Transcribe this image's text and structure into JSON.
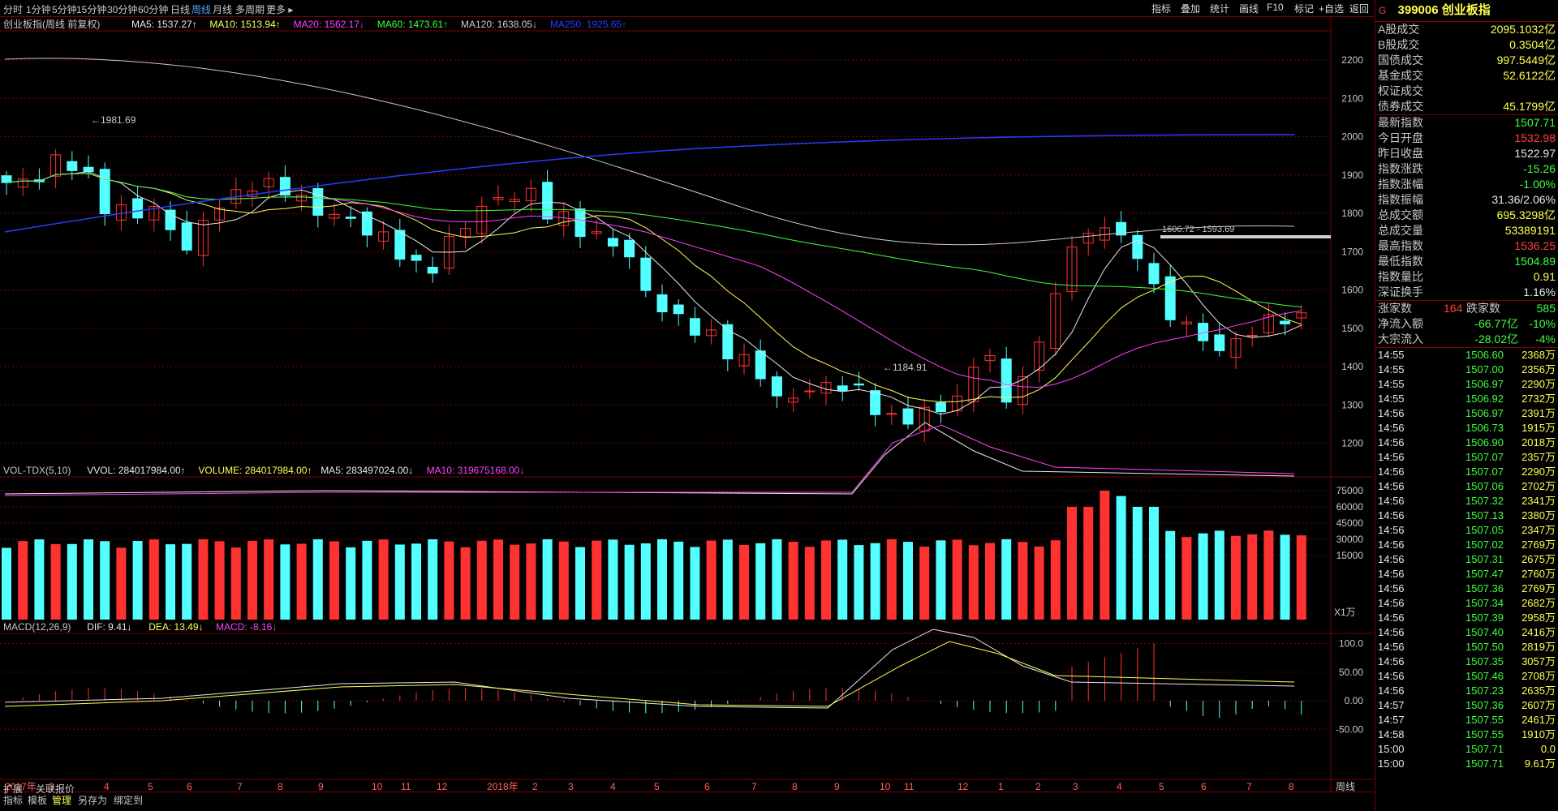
{
  "periods": [
    "分时",
    "1分钟",
    "5分钟",
    "15分钟",
    "30分钟",
    "60分钟",
    "日线",
    "周线",
    "月线",
    "多周期",
    "更多"
  ],
  "active_period": "周线",
  "tools": [
    "指标",
    "叠加",
    "统计",
    "画线",
    "F10",
    "标记",
    "+自选",
    "返回"
  ],
  "main_title": "创业板指(周线 前复权)",
  "ma_legend": [
    {
      "label": "MA5: 1537.27",
      "arrow": "↑",
      "color": "#e8e8e8"
    },
    {
      "label": "MA10: 1513.94",
      "arrow": "↑",
      "color": "#ffff54"
    },
    {
      "label": "MA20: 1562.17",
      "arrow": "↓",
      "color": "#ff40ff"
    },
    {
      "label": "MA60: 1473.61",
      "arrow": "↑",
      "color": "#40ff40"
    },
    {
      "label": "MA120: 1638.05",
      "arrow": "↓",
      "color": "#cccccc"
    },
    {
      "label": "MA250: 1925.65",
      "arrow": "↑",
      "color": "#2b3bff"
    }
  ],
  "price_axis": [
    "2200",
    "2100",
    "2000",
    "1900",
    "1800",
    "1700",
    "1600",
    "1500",
    "1400",
    "1300",
    "1200"
  ],
  "annotations": {
    "high": "1981.69",
    "low": "1184.91",
    "range": "1606.72 - 1593.69"
  },
  "vol_legend": [
    {
      "label": "VOL-TDX(5,10)",
      "color": "#c8c8c8"
    },
    {
      "label": "VVOL: 284017984.00",
      "arrow": "↑",
      "color": "#e8e8e8"
    },
    {
      "label": "VOLUME: 284017984.00",
      "arrow": "↑",
      "color": "#ffff54"
    },
    {
      "label": "MA5: 283497024.00",
      "arrow": "↓",
      "color": "#e8e8e8"
    },
    {
      "label": "MA10: 319675168.00",
      "arrow": "↓",
      "color": "#ff40ff"
    }
  ],
  "vol_axis": [
    "75000",
    "60000",
    "45000",
    "30000",
    "15000"
  ],
  "vol_unit": "X1万",
  "macd_legend": [
    {
      "label": "MACD(12,26,9)",
      "color": "#c8c8c8"
    },
    {
      "label": "DIF: 9.41",
      "arrow": "↓",
      "color": "#e8e8e8"
    },
    {
      "label": "DEA: 13.49",
      "arrow": "↓",
      "color": "#ffff54"
    },
    {
      "label": "MACD: -8.16",
      "arrow": "↓",
      "color": "#ff40ff"
    }
  ],
  "macd_axis": [
    "100.0",
    "50.00",
    "0.00",
    "-50.00"
  ],
  "date_labels": [
    "2017年",
    "3",
    "4",
    "5",
    "6",
    "7",
    "8",
    "9",
    "10",
    "11",
    "12",
    "2018年",
    "2",
    "3",
    "4",
    "5",
    "6",
    "7",
    "8",
    "9",
    "10",
    "11",
    "12",
    "1",
    "2",
    "3",
    "4",
    "5",
    "6",
    "7",
    "8"
  ],
  "date_axis_period": "周线",
  "bottom_tabs": [
    "指标",
    "模板",
    "管理",
    "另存为",
    "绑定到"
  ],
  "bottom_tabs2": [
    "扩展",
    "关联报价"
  ],
  "quote": {
    "code": "399006",
    "name": "创业板指",
    "g": "G",
    "stats1": [
      {
        "l": "A股成交",
        "v": "2095.1032亿",
        "c": "#ffff54"
      },
      {
        "l": "B股成交",
        "v": "0.3504亿",
        "c": "#ffff54"
      },
      {
        "l": "国债成交",
        "v": "997.5449亿",
        "c": "#ffff54"
      },
      {
        "l": "基金成交",
        "v": "52.6122亿",
        "c": "#ffff54"
      },
      {
        "l": "权证成交",
        "v": "",
        "c": "#ffff54"
      },
      {
        "l": "债券成交",
        "v": "45.1799亿",
        "c": "#ffff54"
      }
    ],
    "stats2": [
      {
        "l": "最新指数",
        "v": "1507.71",
        "c": "#40ff40"
      },
      {
        "l": "今日开盘",
        "v": "1532.98",
        "c": "#ff4040"
      },
      {
        "l": "昨日收盘",
        "v": "1522.97",
        "c": "#e8e8e8"
      },
      {
        "l": "指数涨跌",
        "v": "-15.26",
        "c": "#40ff40"
      },
      {
        "l": "指数涨幅",
        "v": "-1.00%",
        "c": "#40ff40"
      },
      {
        "l": "指数振幅",
        "v": "31.36/2.06%",
        "c": "#e8e8e8"
      },
      {
        "l": "总成交额",
        "v": "695.3298亿",
        "c": "#ffff54"
      },
      {
        "l": "总成交量",
        "v": "53389191",
        "c": "#ffff54"
      },
      {
        "l": "最高指数",
        "v": "1536.25",
        "c": "#ff4040"
      },
      {
        "l": "最低指数",
        "v": "1504.89",
        "c": "#40ff40"
      },
      {
        "l": "指数量比",
        "v": "0.91",
        "c": "#ffff54"
      },
      {
        "l": "深证换手",
        "v": "1.16%",
        "c": "#e8e8e8"
      }
    ],
    "up_label": "涨家数",
    "up_count": "164",
    "down_label": "跌家数",
    "down_count": "585",
    "flow": [
      {
        "l": "净流入额",
        "v": "-66.77亿",
        "p": "-10%"
      },
      {
        "l": "大宗流入",
        "v": "-28.02亿",
        "p": "-4%"
      }
    ],
    "ticks": [
      [
        "14:55",
        "1506.60",
        "2368万"
      ],
      [
        "14:55",
        "1507.00",
        "2356万"
      ],
      [
        "14:55",
        "1506.97",
        "2290万"
      ],
      [
        "14:55",
        "1506.92",
        "2732万"
      ],
      [
        "14:56",
        "1506.97",
        "2391万"
      ],
      [
        "14:56",
        "1506.73",
        "1915万"
      ],
      [
        "14:56",
        "1506.90",
        "2018万"
      ],
      [
        "14:56",
        "1507.07",
        "2357万"
      ],
      [
        "14:56",
        "1507.07",
        "2290万"
      ],
      [
        "14:56",
        "1507.06",
        "2702万"
      ],
      [
        "14:56",
        "1507.32",
        "2341万"
      ],
      [
        "14:56",
        "1507.13",
        "2380万"
      ],
      [
        "14:56",
        "1507.05",
        "2347万"
      ],
      [
        "14:56",
        "1507.02",
        "2769万"
      ],
      [
        "14:56",
        "1507.31",
        "2675万"
      ],
      [
        "14:56",
        "1507.47",
        "2760万"
      ],
      [
        "14:56",
        "1507.36",
        "2769万"
      ],
      [
        "14:56",
        "1507.34",
        "2682万"
      ],
      [
        "14:56",
        "1507.39",
        "2958万"
      ],
      [
        "14:56",
        "1507.40",
        "2416万"
      ],
      [
        "14:56",
        "1507.50",
        "2819万"
      ],
      [
        "14:56",
        "1507.35",
        "3057万"
      ],
      [
        "14:56",
        "1507.46",
        "2708万"
      ],
      [
        "14:56",
        "1507.23",
        "2635万"
      ],
      [
        "14:57",
        "1507.36",
        "2607万"
      ],
      [
        "14:57",
        "1507.55",
        "2461万"
      ],
      [
        "14:58",
        "1507.55",
        "1910万"
      ],
      [
        "15:00",
        "1507.71",
        "0.0"
      ],
      [
        "15:00",
        "1507.71",
        "9.61万"
      ]
    ]
  },
  "colors": {
    "up": "#ff3232",
    "down": "#54ffff",
    "grid": "#7a0000"
  }
}
